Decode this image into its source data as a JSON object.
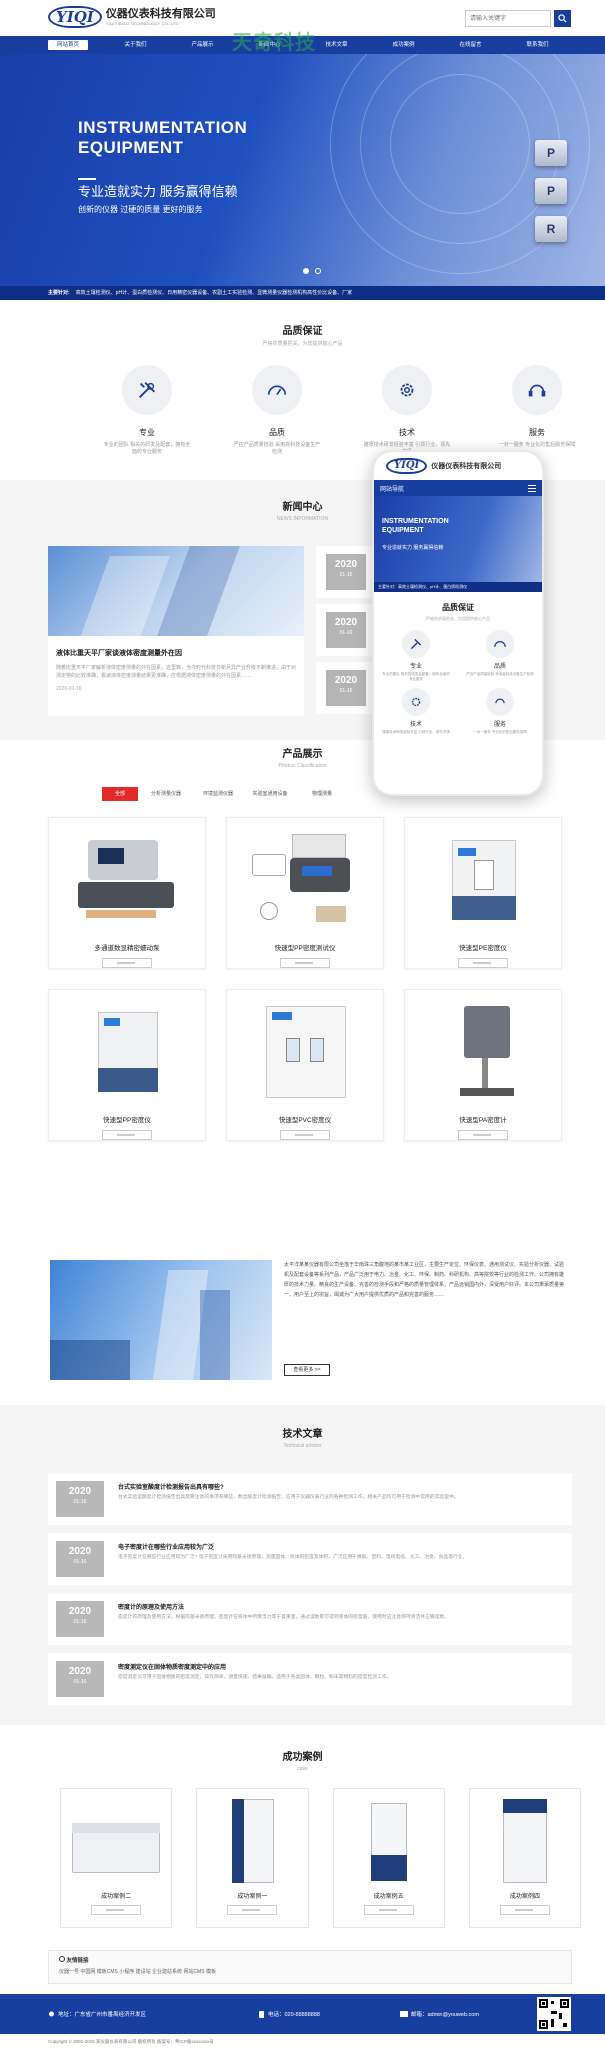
{
  "header": {
    "logo_mark": "YIQI",
    "company": "仪器仪表科技有限公司",
    "company_en": "YIQIYIBIAO TECHNOLOGY CO.,LTD",
    "search_placeholder": "请输入关键字"
  },
  "watermark": "天奇科技",
  "nav": {
    "items": [
      "网站首页",
      "关于我们",
      "产品展示",
      "新闻中心",
      "技术文章",
      "成功案例",
      "在线留言",
      "联系我们"
    ]
  },
  "banner": {
    "title_line1": "INSTRUMENTATION",
    "title_line2": "EQUIPMENT",
    "slogan": "专业造就实力 服务赢得信赖",
    "subslogan": "创新的仪器 过硬的质量 更好的服务",
    "keys": [
      "P",
      "P",
      "R"
    ],
    "dots_active": 0
  },
  "hot": {
    "label": "主要针对:",
    "text": "高效土壤检测仪、pH计、蛋白质检测仪、日用精密仪器设备、农副土工实验检测、显微测量仪器检测机构高性价比设备、厂家"
  },
  "quality": {
    "title": "品质保证",
    "subtitle": "严格的质量把关，为您提供放心产品",
    "items": [
      {
        "name": "专业",
        "desc": "专业的团队\n相关的研发及配套，拥有全面的专业服务",
        "icon": "tools-icon"
      },
      {
        "name": "品质",
        "desc": "严控产品质量检验\n采用高科技设备生产检测",
        "icon": "gauge-icon"
      },
      {
        "name": "技术",
        "desc": "雄厚技术研发经验丰富\n引领行业，领先市场",
        "icon": "gear-icon"
      },
      {
        "name": "服务",
        "desc": "一对一服务\n专业化的售后服务保障",
        "icon": "headset-icon"
      }
    ]
  },
  "news": {
    "title": "新闻中心",
    "subtitle": "NEWS INFORMATION",
    "main_title": "液体比重天平厂家谈液体密度测量外在因",
    "main_desc": "随着比重天平厂家解析液体密度测量的外在因素，这里数，当今时代科技日新月异产业升级不断推进，由于对测定物的比较准确，极速液体密度测量结果更准确，应根据液体密度测量的外在因素……",
    "main_date": "2020-01-16",
    "side": [
      {
        "year": "2020",
        "date": "01-16"
      },
      {
        "year": "2020",
        "date": "01-16"
      },
      {
        "year": "2020",
        "date": "01-16"
      }
    ]
  },
  "products": {
    "title": "产品展示",
    "subtitle": "Product Classification",
    "tabs": [
      "全部",
      "分析测量仪器",
      "环境监测仪器",
      "实验室通用设备",
      "物理测量"
    ],
    "items": [
      {
        "name": "多通道数显精密蠕动泵"
      },
      {
        "name": "快速型PP密度测试仪"
      },
      {
        "name": "快速型PE密度仪"
      },
      {
        "name": "快速型PP密度仪"
      },
      {
        "name": "快速型PVC密度仪"
      },
      {
        "name": "快速型PA密度计"
      }
    ]
  },
  "about": {
    "text": "太平洋某某仪器有限公司坐落于华南珠三角腹地的某市某工业区，主要生产定位、环保仪表、通用测试仪、实验分析仪器、试验机及配套设备等系列产品，产品广泛用于电力、冶金、化工、环保、制药、科研机构、高等院校等行业的检测工作。公司拥有雄厚的技术力量、精良的生产设备、完善的检测手段和严格的质量管理体系，产品远销国内外，深受用户好评。本公司秉承质量第一、用户至上的宗旨，竭诚为广大用户提供优质的产品和完善的服务……",
    "more": "查看更多 >>"
  },
  "tech": {
    "title": "技术文章",
    "subtitle": "Technical articles",
    "items": [
      {
        "year": "2020",
        "date": "01-16",
        "title": "台式实验室酸度计检测报告出具有哪些?",
        "desc": "台式实验室酸度计检测报告出具需要注意的事项有哪些，数显酸度计检测报告，应用于仪器仪表行业的各种检测工作，相关产品均可用于检测中常用的实验室中。"
      },
      {
        "year": "2020",
        "date": "01-16",
        "title": "电子密度计在哪些行业应用较为广泛",
        "desc": "电子密度计在哪些行业应用较为广泛? 电子密度计采用阿基米德原理，测量固体、液体的密度及体积，广泛应用于橡胶、塑料、电线电缆、化工、冶金、食品等行业。"
      },
      {
        "year": "2020",
        "date": "01-16",
        "title": "密度计的原理及使用方法",
        "desc": "密度计的原理及使用方法，根据阿基米德原理，密度计在液体中所受浮力等于其重量，通过读数即可得到液体的密度值，使用时应注意保持清洁并正确读数。"
      },
      {
        "year": "2020",
        "date": "01-16",
        "title": "密度测定仪在固体物质密度测定中的应用",
        "desc": "密度测定仪可用于固体物质的密度测定，操作简单、测量快速、结果准确，适用于各类固体、颗粒、粉末等物料的密度检测工作。"
      }
    ]
  },
  "cases": {
    "title": "成功案例",
    "subtitle": "case",
    "items": [
      {
        "name": "成功案例二"
      },
      {
        "name": "成功案例一"
      },
      {
        "name": "成功案例五"
      },
      {
        "name": "成功案例四"
      }
    ]
  },
  "links": {
    "title": "友情链接",
    "text": "仪器一号  中国网  模板CMS 小程序  建设站  企业建站系统  网站CMS  模板"
  },
  "footer": {
    "address": "地址：广东省广州市番禺经济开发区",
    "phone": "电话：020-88888888",
    "email": "邮箱：admin@youweb.com",
    "copyright": "Copyright © 2002-2020 某仪器仪表有限公司 版权所有  备案号：粤ICP备xxxxxxxx号"
  },
  "phone": {
    "nav_label": "网站导航",
    "banner_title1": "INSTRUMENTATION",
    "banner_title2": "EQUIPMENT",
    "banner_slogan": "专业造就实力 服务赢得信赖",
    "hot": "主要针对：高效土壤检测仪、pH计、蛋白质检测仪",
    "quality_title": "品质保证",
    "quality_sub": "严格的质量把关，为您提供放心产品",
    "items": [
      {
        "name": "专业",
        "desc": "专业的团队\n相关的研发及配套，拥有全面的专业服务"
      },
      {
        "name": "品质",
        "desc": "严控产品质量检验\n采用高科技设备生产检测"
      },
      {
        "name": "技术",
        "desc": "雄厚技术研发经验丰富\n引领行业，领先市场"
      },
      {
        "name": "服务",
        "desc": "一对一服务\n专业化的售后服务保障"
      }
    ]
  },
  "colors": {
    "primary": "#183fa0",
    "accent": "#e22a2a",
    "date_box": "#b5b5b5"
  }
}
